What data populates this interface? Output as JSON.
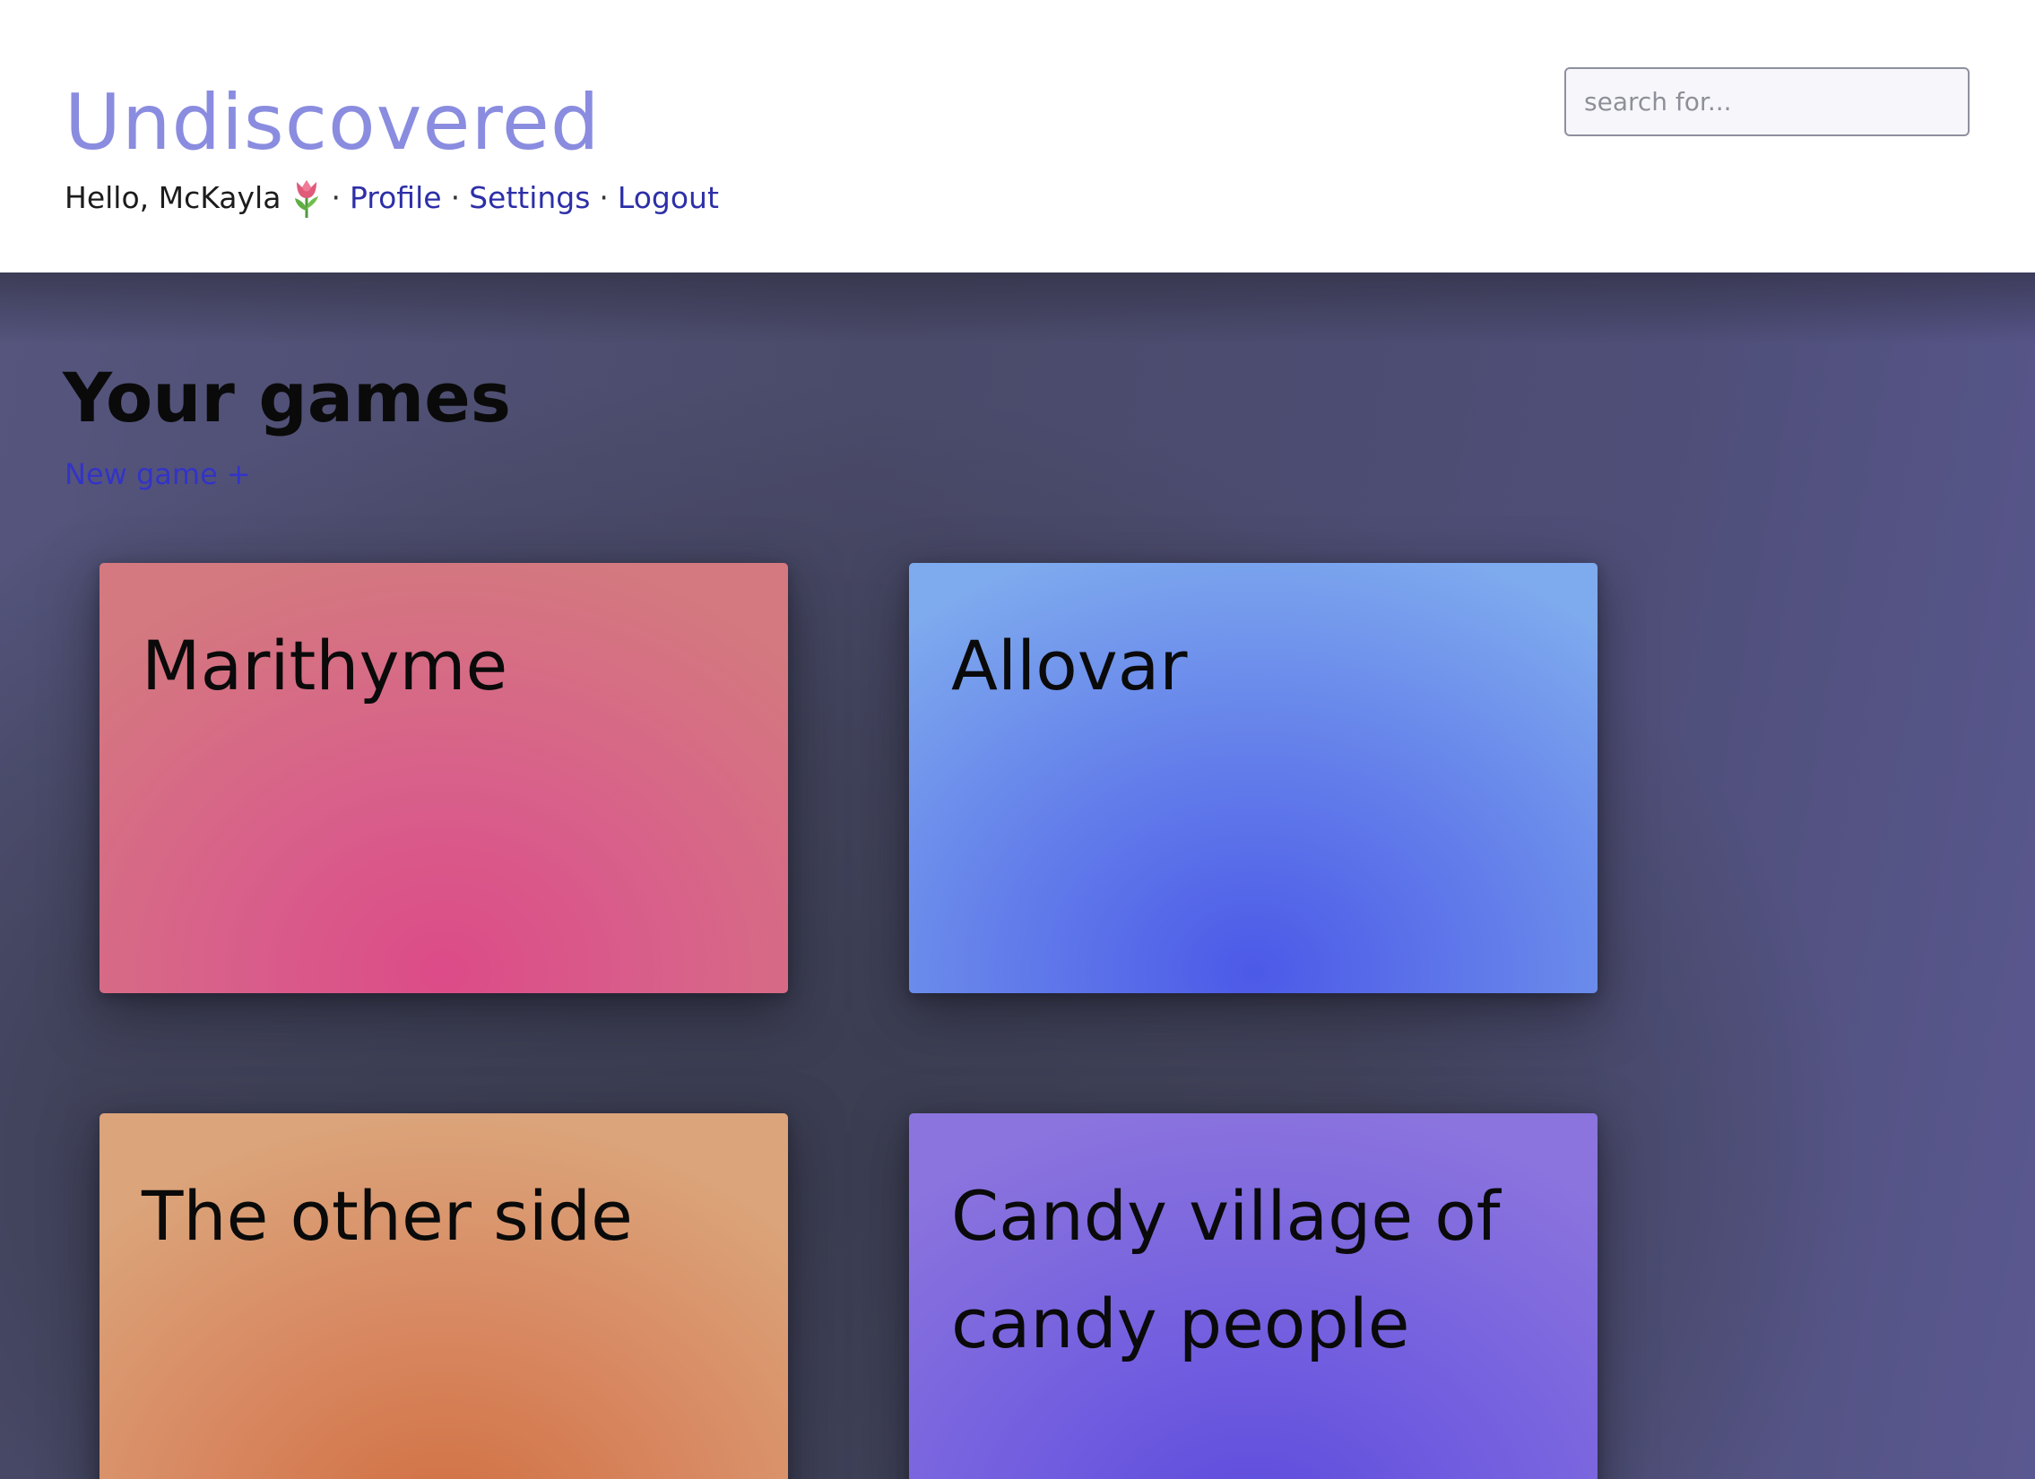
{
  "header": {
    "brand": "Undiscovered",
    "greeting": "Hello, McKayla",
    "greeting_icon": "tulip-icon",
    "separator": "·",
    "nav": {
      "profile": "Profile",
      "settings": "Settings",
      "logout": "Logout"
    },
    "search": {
      "placeholder": "search for...",
      "value": ""
    }
  },
  "main": {
    "title": "Your games",
    "new_game_label": "New game +",
    "games": [
      {
        "title": "Marithyme",
        "color": "#dc4b88"
      },
      {
        "title": "Allovar",
        "color": "#4c59e8"
      },
      {
        "title": "The other side",
        "color": "#d06e40"
      },
      {
        "title": "Candy village of candy people",
        "color": "#5b4ade"
      }
    ]
  },
  "colors": {
    "brand": "#8a8ce0",
    "link": "#2d2fa8",
    "new_game_link": "#3333c7",
    "background": "#45465f"
  }
}
